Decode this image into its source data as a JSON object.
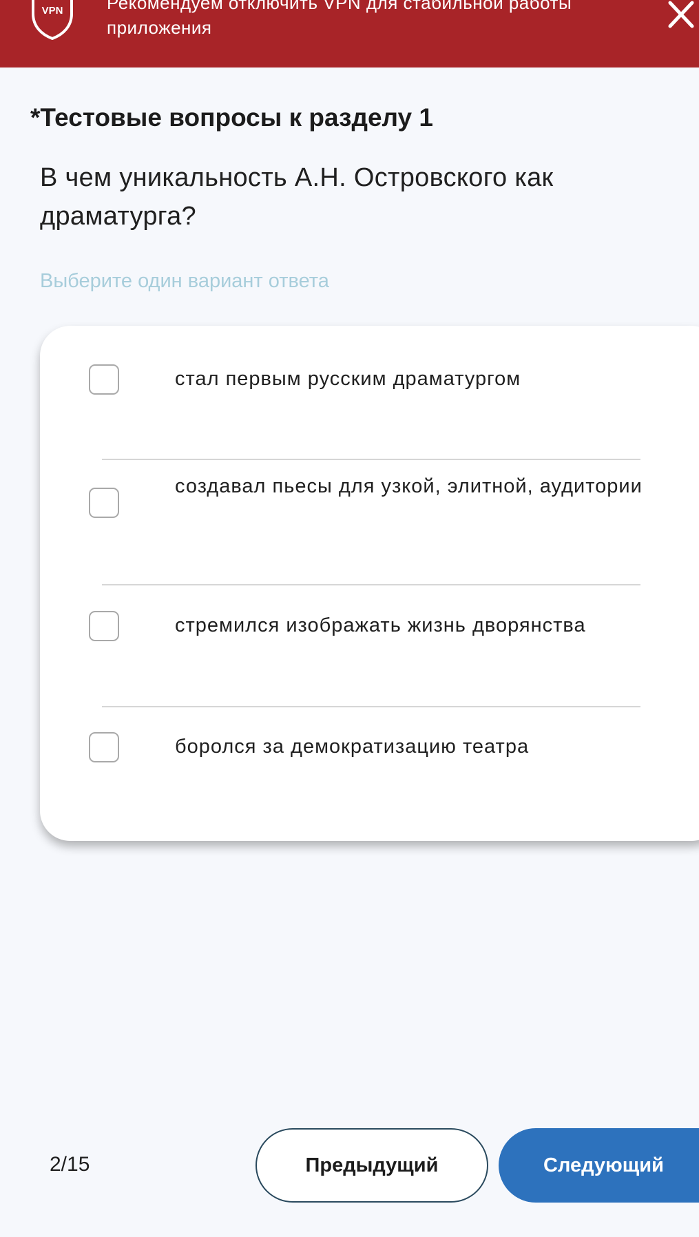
{
  "banner": {
    "icon_text": "VPN",
    "message": "Рекомендуем отключить VPN для стабильной работы приложения",
    "close_icon": "close-icon",
    "background_color": "#a82428"
  },
  "section": {
    "title": "*Тестовые вопросы к разделу 1"
  },
  "question": {
    "text": "В чем уникальность А.Н. Островского как драматурга?",
    "hint": "Выберите один вариант ответа"
  },
  "options": [
    {
      "label": "стал первым русским драматургом",
      "checked": false
    },
    {
      "label": "создавал пьесы для узкой, элитной, аудитории",
      "checked": false
    },
    {
      "label": "стремился изображать жизнь дворянства",
      "checked": false
    },
    {
      "label": "боролся за демократизацию театра",
      "checked": false
    }
  ],
  "footer": {
    "counter": "2/15",
    "prev_label": "Предыдущий",
    "next_label": "Следующий",
    "accent_color": "#2d72bd"
  }
}
